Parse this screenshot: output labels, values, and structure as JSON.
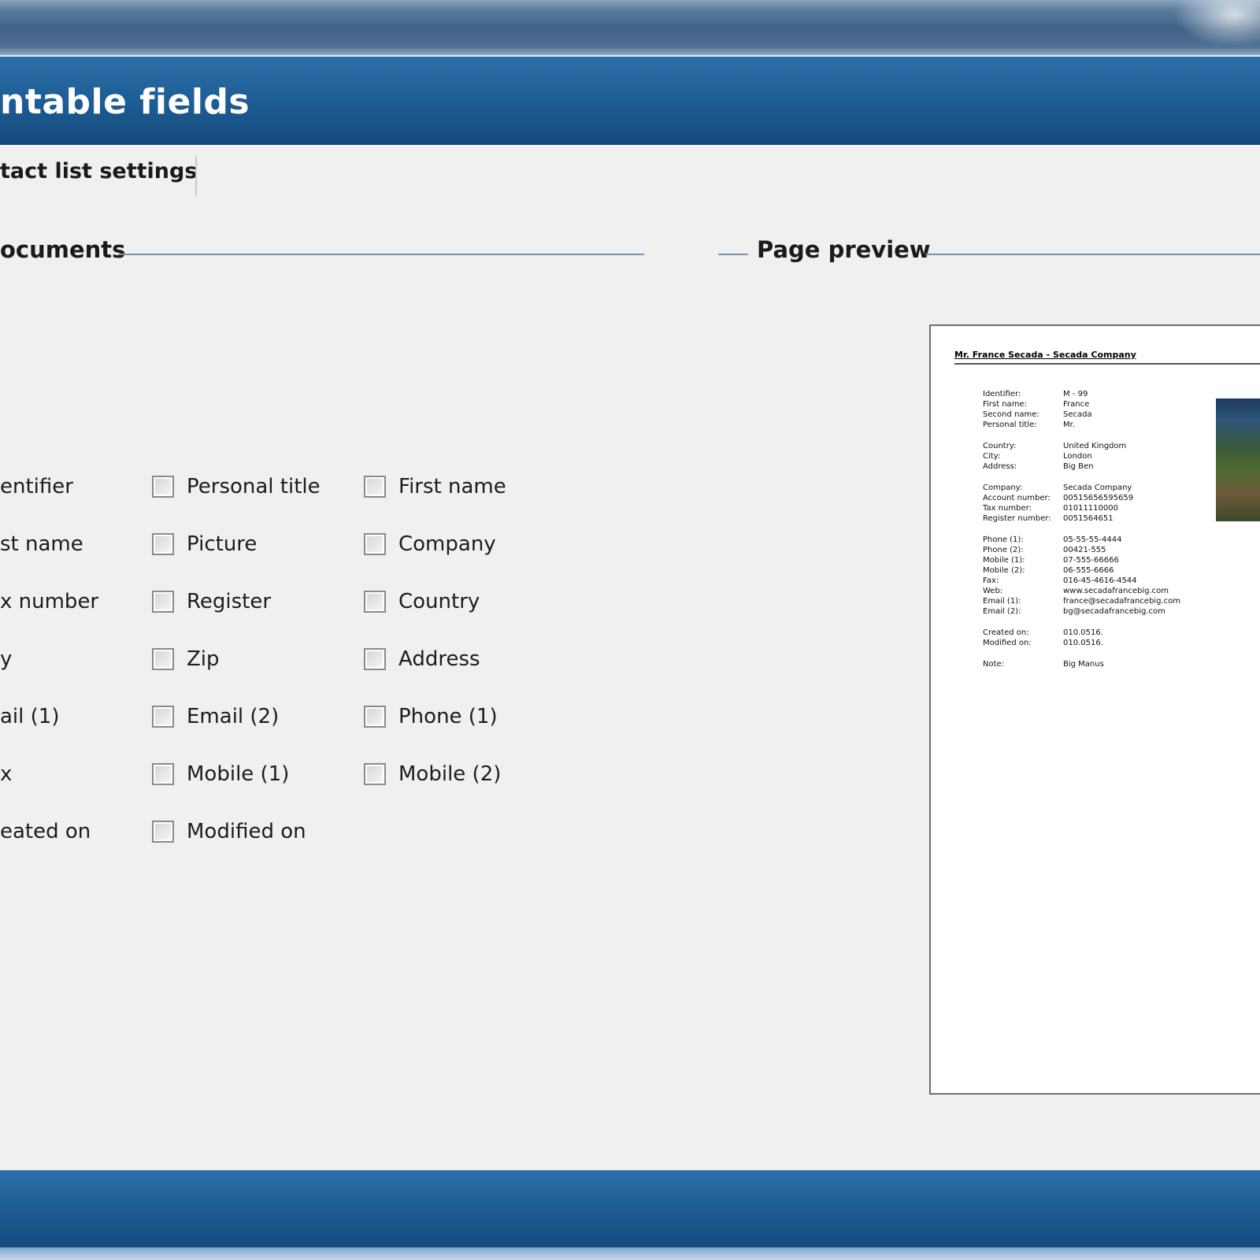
{
  "header": {
    "title": "ntable fields"
  },
  "tabs": [
    {
      "label": "tact list settings"
    }
  ],
  "sections": {
    "left_title": "ocuments",
    "right_title": "Page preview"
  },
  "fields": {
    "col0": [
      "entifier",
      "st name",
      "x number",
      "y",
      "ail (1)",
      "x",
      "eated on"
    ],
    "col1": [
      "Personal title",
      "Picture",
      "Register",
      "Zip",
      "Email (2)",
      "Mobile (1)",
      "Modified on"
    ],
    "col2": [
      "First name",
      "Company",
      "Country",
      "Address",
      "Phone (1)",
      "Mobile (2)"
    ]
  },
  "preview": {
    "heading": "Mr. France Secada - Secada Company",
    "rows": [
      {
        "k": "Identifier:",
        "v": "M - 99"
      },
      {
        "k": "First name:",
        "v": "France"
      },
      {
        "k": "Second name:",
        "v": "Secada"
      },
      {
        "k": "Personal title:",
        "v": "Mr."
      },
      {
        "k": "Country:",
        "v": "United Kingdom"
      },
      {
        "k": "City:",
        "v": "London"
      },
      {
        "k": "Address:",
        "v": "Big Ben"
      },
      {
        "k": "Company:",
        "v": "Secada Company"
      },
      {
        "k": "Account number:",
        "v": "00515656595659"
      },
      {
        "k": "Tax number:",
        "v": "01011110000"
      },
      {
        "k": "Register number:",
        "v": "0051564651"
      },
      {
        "k": "Phone (1):",
        "v": "05-55-55-4444"
      },
      {
        "k": "Phone (2):",
        "v": "00421-555"
      },
      {
        "k": "Mobile (1):",
        "v": "07-555-66666"
      },
      {
        "k": "Mobile (2):",
        "v": "06-555-6666"
      },
      {
        "k": "Fax:",
        "v": "016-45-4616-4544"
      },
      {
        "k": "Web:",
        "v": "www.secadafrancebig.com"
      },
      {
        "k": "Email (1):",
        "v": "france@secadafrancebig.com"
      },
      {
        "k": "Email (2):",
        "v": "bg@secadafrancebig.com"
      },
      {
        "k": "Created on:",
        "v": "010.0516."
      },
      {
        "k": "Modified on:",
        "v": "010.0516."
      },
      {
        "k": "Note:",
        "v": "Big Manus"
      }
    ]
  },
  "colors": {
    "accent": "#1f5f97",
    "rule": "#7a93ad"
  }
}
